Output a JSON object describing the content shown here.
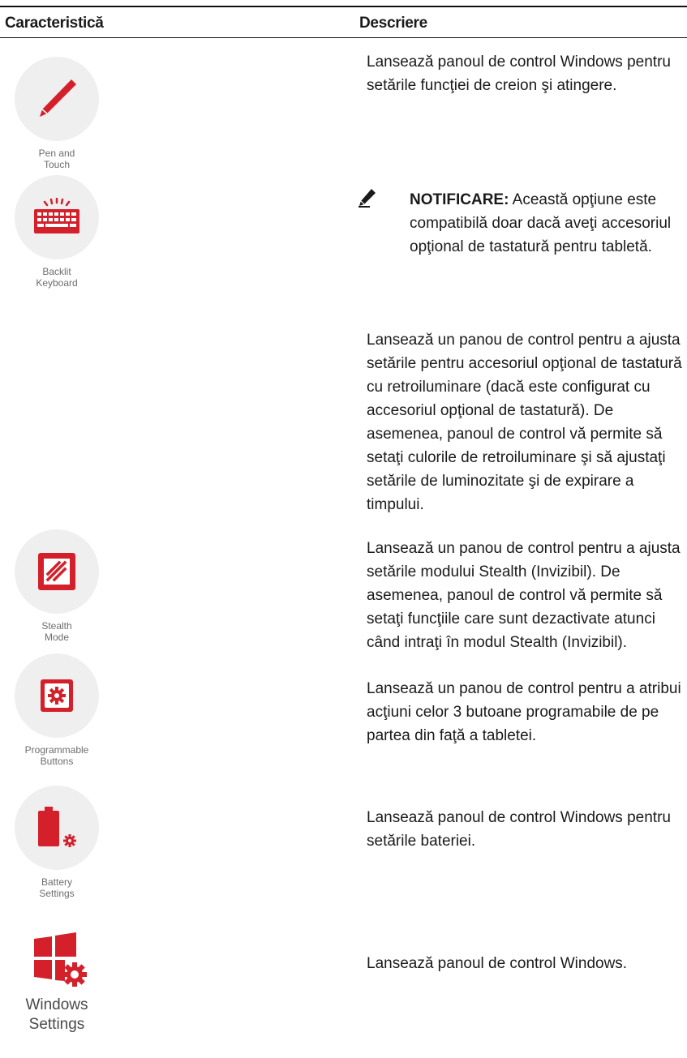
{
  "header": {
    "feature": "Caracteristică",
    "description": "Descriere"
  },
  "accent_color": "#d4202a",
  "rows": [
    {
      "icon": "pen-icon",
      "caption": "Pen and\nTouch",
      "description": "Lansează panoul de control Windows pentru setările funcţiei de creion şi atingere."
    },
    {
      "icon": "backlit-keyboard-icon",
      "caption": "Backlit\nKeyboard",
      "note_label": "NOTIFICARE:",
      "note_text": "Această opţiune este compatibilă doar dacă aveţi accesoriul opţional de tastatură pentru tabletă.",
      "description": "Lansează un panou de control pentru a ajusta setările pentru accesoriul opţional de tastatură cu retroiluminare (dacă este configurat cu accesoriul opţional de tastatură). De asemenea, panoul de control vă permite să setaţi culorile de retroiluminare şi să ajustaţi setările de luminozitate şi de expirare a timpului."
    },
    {
      "icon": "stealth-mode-icon",
      "caption": "Stealth\nMode",
      "description": "Lansează un panou de control pentru a ajusta setările modului Stealth (Invizibil). De asemenea, panoul de control vă permite să setaţi funcţiile care sunt dezactivate atunci când intraţi în modul Stealth (Invizibil)."
    },
    {
      "icon": "programmable-buttons-icon",
      "caption": "Programmable\nButtons",
      "description": "Lansează un panou de control pentru a atribui acţiuni celor 3 butoane programabile de pe partea din faţă a tabletei."
    },
    {
      "icon": "battery-settings-icon",
      "caption": "Battery\nSettings",
      "description": "Lansează panoul de control Windows pentru setările bateriei."
    },
    {
      "icon": "windows-settings-icon",
      "caption": "Windows\nSettings",
      "description": "Lansează panoul de control Windows."
    }
  ]
}
